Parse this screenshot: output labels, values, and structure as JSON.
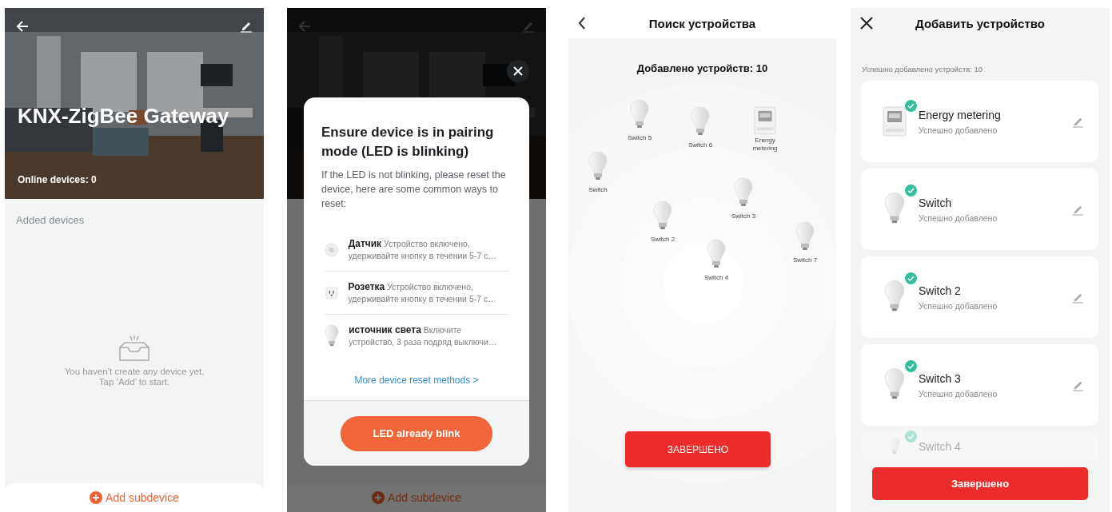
{
  "screens": [
    {
      "kind": "gateway",
      "title": "KNX-ZigBee Gateway",
      "online": "Online devices: 0",
      "section_label": "Added devices",
      "empty_text": "You haven’t create any device yet.\nTap ‘Add’ to start.",
      "add_button": "Add subdevice"
    },
    {
      "kind": "gateway_modal",
      "add_button": "Add subdevice",
      "modal": {
        "title": "Ensure device is in pairing mode (LED is blinking)",
        "intro": "If the LED is not blinking, please reset the device, here are some common ways to reset:",
        "methods": [
          {
            "kind": "sensor",
            "name": "Датчик",
            "description": "Устройство включено, удерживайте кнопку в течении 5-7 с…"
          },
          {
            "kind": "outlet",
            "name": "Розетка",
            "description": "Устройство включено, удерживайте кнопку в течении 5-7 с…"
          },
          {
            "kind": "bulb",
            "name": "источник света",
            "description": "Включите устройство, 3 раза подряд выключи…"
          }
        ],
        "link": "More device reset methods >",
        "button": "LED already blink"
      }
    },
    {
      "kind": "search",
      "title": "Поиск устройства",
      "count": "Добавлено устройств: 10",
      "devices": [
        {
          "kind": "bulb",
          "name": "Switch 5"
        },
        {
          "kind": "bulb",
          "name": "Switch 6"
        },
        {
          "kind": "meter",
          "name": "Energy metering"
        },
        {
          "kind": "bulb",
          "name": "Switch"
        },
        {
          "kind": "bulb",
          "name": "Switch 3"
        },
        {
          "kind": "bulb",
          "name": "Switch 2"
        },
        {
          "kind": "bulb",
          "name": "Switch 7"
        },
        {
          "kind": "bulb",
          "name": "Switch 4"
        }
      ],
      "button": "ЗАВЕРШЕНО"
    },
    {
      "kind": "added",
      "title": "Добавить устройство",
      "summary": "Успешно добавлено устройств: 10",
      "devices": [
        {
          "kind": "meter",
          "name": "Energy metering",
          "status": "Успешно добавлено",
          "faded": false
        },
        {
          "kind": "bulb",
          "name": "Switch",
          "status": "Успешно добавлено",
          "faded": false
        },
        {
          "kind": "bulb",
          "name": "Switch 2",
          "status": "Успешно добавлено",
          "faded": false
        },
        {
          "kind": "bulb",
          "name": "Switch 3",
          "status": "Успешно добавлено",
          "faded": false
        },
        {
          "kind": "bulb",
          "name": "Switch 4",
          "faded": true
        }
      ],
      "button": "Завершено"
    }
  ]
}
